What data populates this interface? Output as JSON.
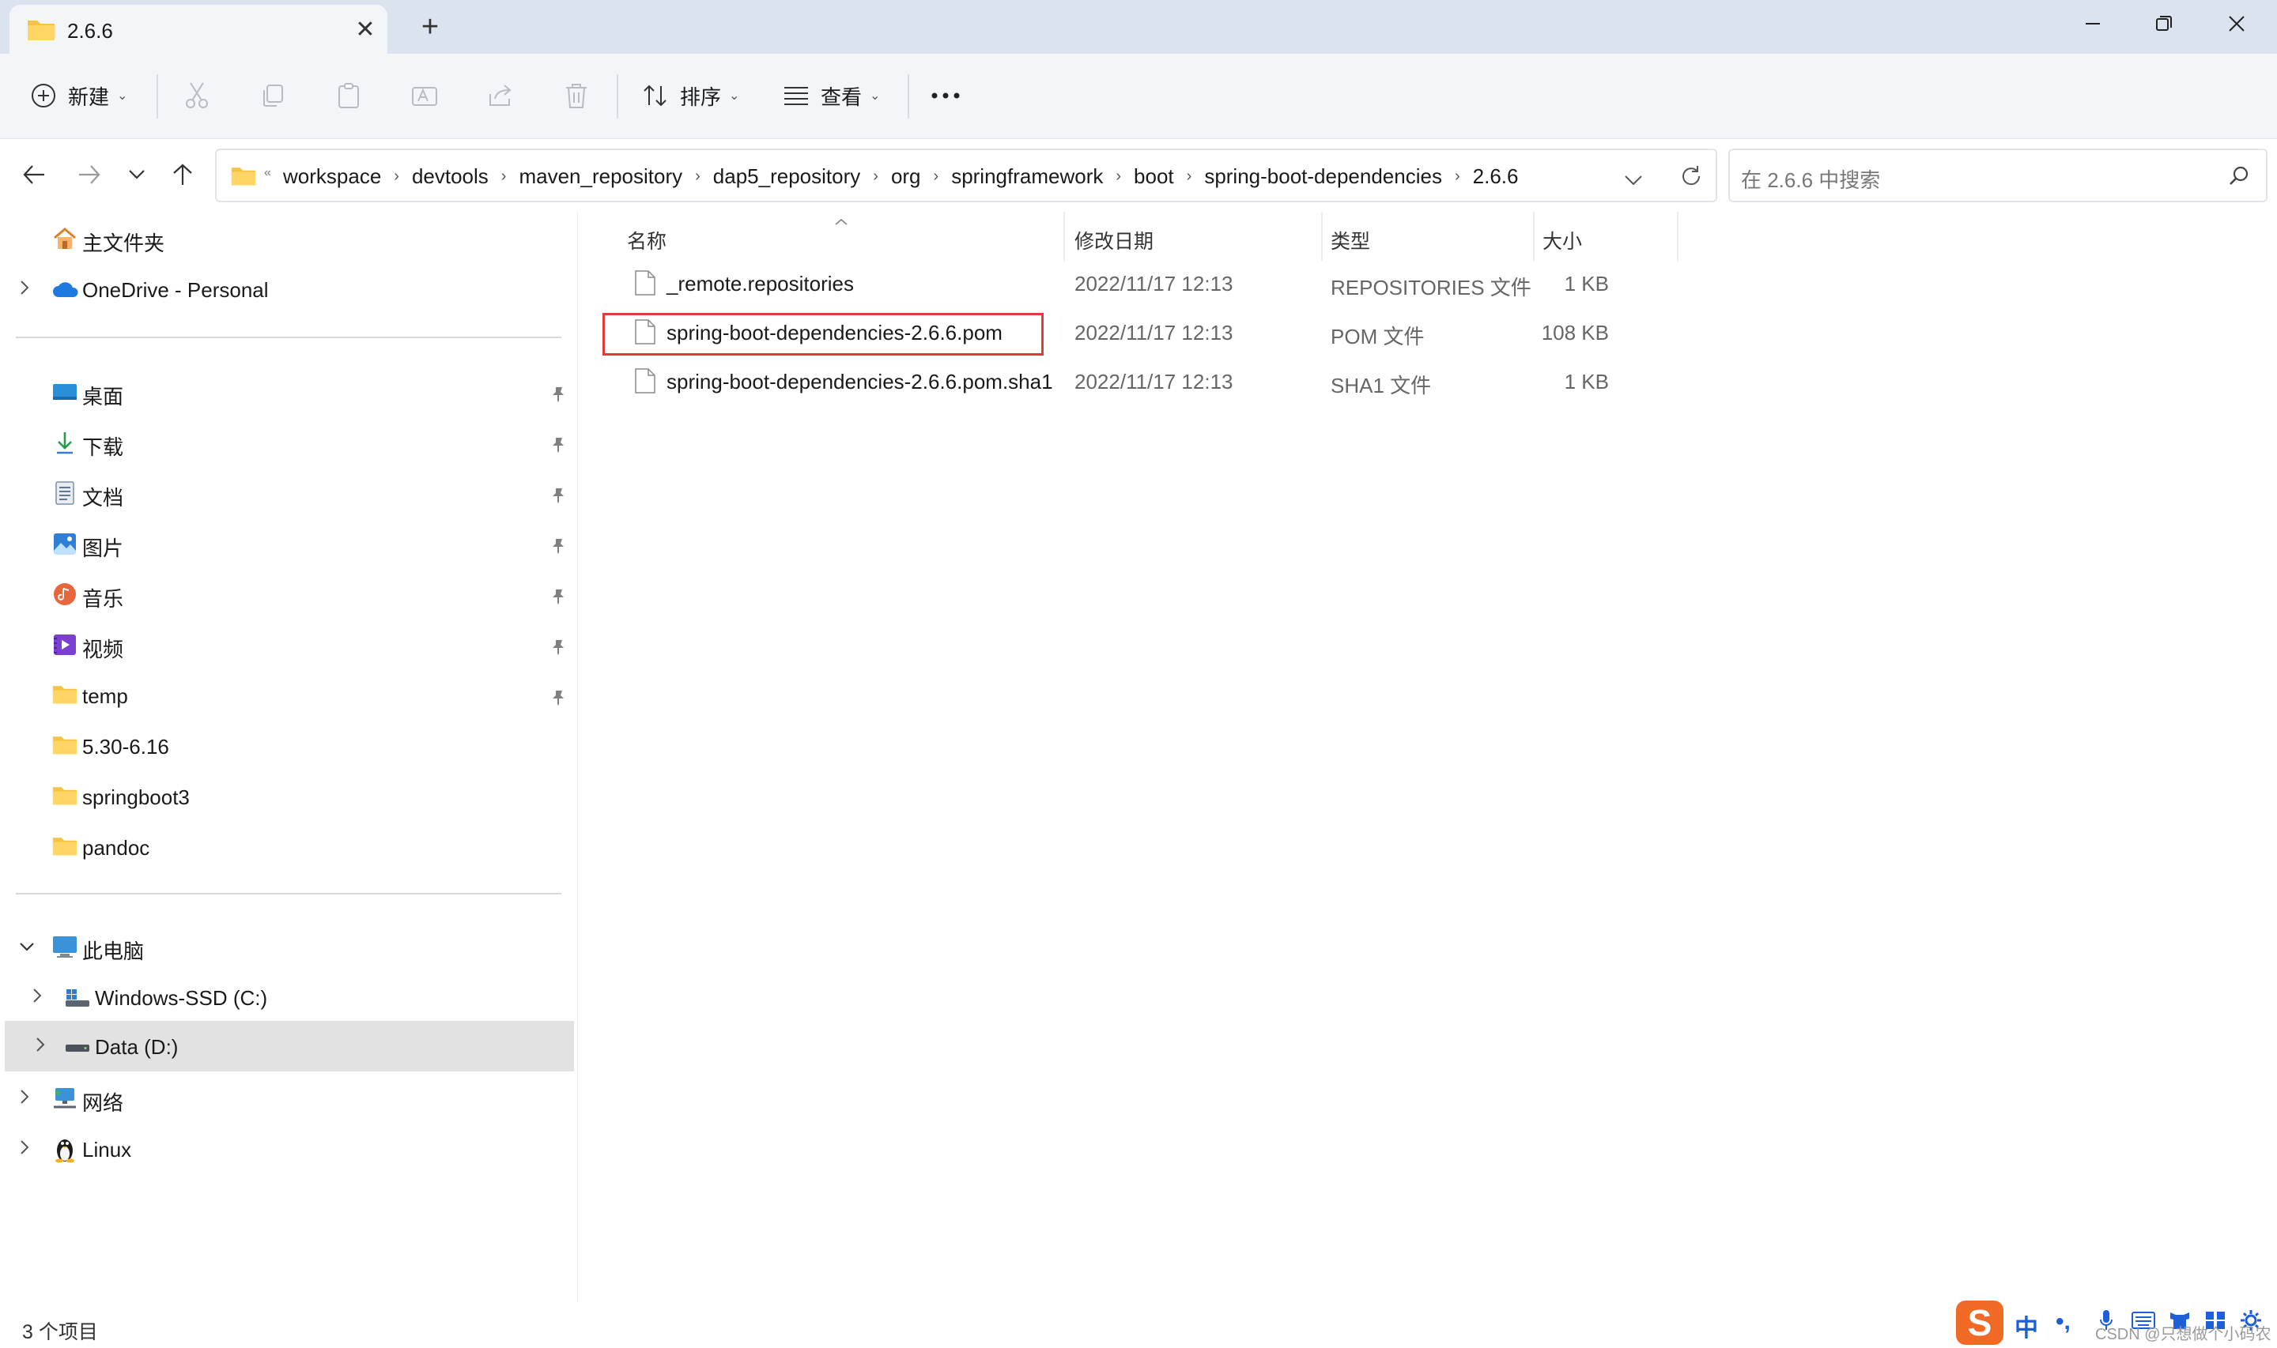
{
  "window": {
    "tab_title": "2.6.6",
    "tab_close_glyph": "✕",
    "new_tab_glyph": "+"
  },
  "toolbar": {
    "new_label": "新建",
    "sort_label": "排序",
    "view_label": "查看",
    "more_glyph": "···",
    "chevron": "⌄"
  },
  "address": {
    "overflow": "«",
    "breadcrumbs": [
      "workspace",
      "devtools",
      "maven_repository",
      "dap5_repository",
      "org",
      "springframework",
      "boot",
      "spring-boot-dependencies",
      "2.6.6"
    ],
    "separator": "›"
  },
  "search": {
    "placeholder": "在 2.6.6 中搜索"
  },
  "sidebar": {
    "home": "主文件夹",
    "onedrive": "OneDrive - Personal",
    "quick_access": [
      {
        "label": "桌面",
        "icon": "desktop-icon",
        "pinned": true
      },
      {
        "label": "下载",
        "icon": "download-icon",
        "pinned": true
      },
      {
        "label": "文档",
        "icon": "document-icon",
        "pinned": true
      },
      {
        "label": "图片",
        "icon": "pictures-icon",
        "pinned": true
      },
      {
        "label": "音乐",
        "icon": "music-icon",
        "pinned": true
      },
      {
        "label": "视频",
        "icon": "video-icon",
        "pinned": true
      },
      {
        "label": "temp",
        "icon": "folder-icon",
        "pinned": true
      },
      {
        "label": "5.30-6.16",
        "icon": "folder-icon",
        "pinned": false
      },
      {
        "label": "springboot3",
        "icon": "folder-icon",
        "pinned": false
      },
      {
        "label": "pandoc",
        "icon": "folder-icon",
        "pinned": false
      }
    ],
    "this_pc": "此电脑",
    "drive_c": "Windows-SSD (C:)",
    "drive_d": "Data (D:)",
    "network": "网络",
    "linux": "Linux"
  },
  "columns": {
    "name": "名称",
    "date": "修改日期",
    "type": "类型",
    "size": "大小"
  },
  "files": [
    {
      "name": "_remote.repositories",
      "date": "2022/11/17 12:13",
      "type": "REPOSITORIES 文件",
      "size": "1 KB"
    },
    {
      "name": "spring-boot-dependencies-2.6.6.pom",
      "date": "2022/11/17 12:13",
      "type": "POM 文件",
      "size": "108 KB"
    },
    {
      "name": "spring-boot-dependencies-2.6.6.pom.sha1",
      "date": "2022/11/17 12:13",
      "type": "SHA1 文件",
      "size": "1 KB"
    }
  ],
  "status": {
    "item_count": "3 个项目"
  },
  "ime": {
    "logo": "S",
    "mode": "中",
    "punct": "•,"
  },
  "watermark": "CSDN @只想做个小码农",
  "colors": {
    "highlight_border": "#e03c3c",
    "folder_yellow": "#f5c242",
    "titlebar": "#dbe4ee",
    "selected_row": "#e2e2e2"
  }
}
